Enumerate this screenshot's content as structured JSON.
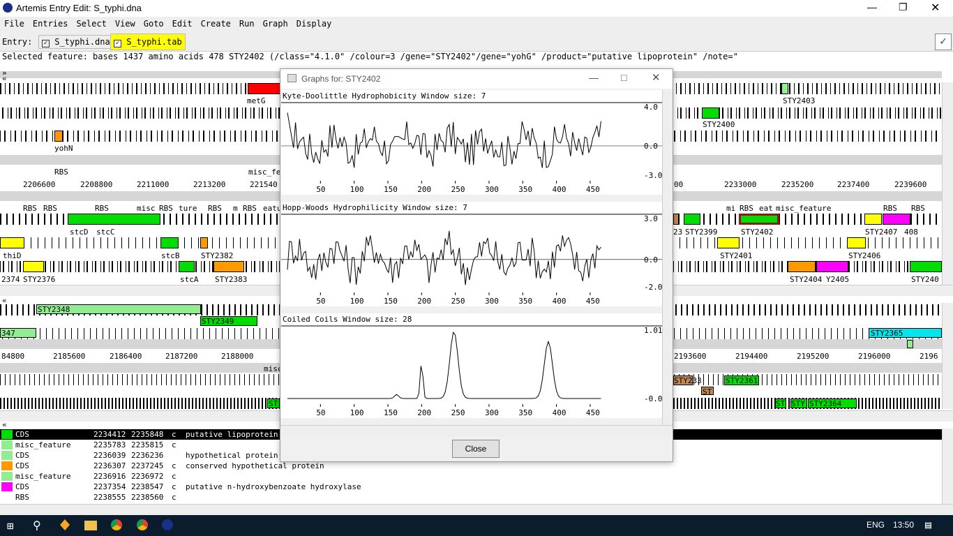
{
  "window": {
    "title": "Artemis Entry Edit: S_typhi.dna"
  },
  "menu": [
    "File",
    "Entries",
    "Select",
    "View",
    "Goto",
    "Edit",
    "Create",
    "Run",
    "Graph",
    "Display"
  ],
  "entry": {
    "label": "Entry:",
    "entries": [
      {
        "name": "S_typhi.dna",
        "checked": true
      },
      {
        "name": "S_typhi.tab",
        "checked": true
      }
    ]
  },
  "selected_feature": "Selected feature:  bases 1437  amino acids 478  STY2402  (/class=\"4.1.0\" /colour=3 /gene=\"STY2402\"/gene=\"yohG\" /product=\"putative lipoprotein\" /note=\"",
  "upper_view": {
    "left_labels": [
      "metG",
      "yohN",
      "RBS",
      "misc_fe",
      "stcD",
      "stcC",
      "thiD",
      "stcB",
      "STY2382",
      "STY2376",
      "stcA",
      "STY2383",
      "2374"
    ],
    "right_labels": [
      "STY2403",
      "STY2400",
      "STY2399",
      "STY2402",
      "STY2407",
      "408",
      "STY2401",
      "STY2406",
      "STY2404",
      "Y2405",
      "STY240",
      "23",
      "mi",
      "RBS",
      "eat",
      "misc_feature",
      "RBS",
      "RBS"
    ],
    "rbs_labels": [
      "RBS",
      "RBS",
      "RBS",
      "misc",
      "RBS",
      "ture",
      "RBS",
      "m",
      "RBS",
      "eatu"
    ],
    "ruler_left": [
      "2206600",
      "2208800",
      "2211000",
      "2213200",
      "221540"
    ],
    "ruler_right": [
      "00",
      "2233000",
      "2235200",
      "2237400",
      "2239600"
    ]
  },
  "lower_view": {
    "labels": [
      "STY2348",
      "STY2349",
      "347",
      "misc",
      "STY2365",
      "STY233",
      "ST",
      "STY2361",
      "ST",
      "STY",
      "STY2364",
      "ST"
    ],
    "ruler_left": [
      "84800",
      "2185600",
      "2186400",
      "2187200",
      "2188000"
    ],
    "ruler_right": [
      "2193600",
      "2194400",
      "2195200",
      "2196000",
      "2196"
    ]
  },
  "dialog": {
    "title": "Graphs for: STY2402",
    "close_label": "Close",
    "graphs": [
      {
        "title": "Kyte-Doolittle Hydrophobicity  Window size: 7",
        "ymax": "4.0",
        "ymid": "0.0",
        "ymin": "-3.0"
      },
      {
        "title": "Hopp-Woods Hydrophilicity  Window size: 7",
        "ymax": "3.0",
        "ymid": "0.0",
        "ymin": "-2.0"
      },
      {
        "title": "Coiled Coils  Window size: 28",
        "ymax": "1.01",
        "ymin": "-0.01"
      }
    ],
    "x_ticks": [
      "50",
      "100",
      "150",
      "200",
      "250",
      "300",
      "350",
      "400",
      "450"
    ]
  },
  "feature_list": [
    {
      "key": "CDS",
      "start": "2234412",
      "end": "2235848",
      "strand": "c",
      "note": "putative lipoprotein",
      "color": "#00dd00",
      "selected": true
    },
    {
      "key": "misc_feature",
      "start": "2235783",
      "end": "2235815",
      "strand": "c",
      "note": "",
      "color": "#90ee90",
      "selected": false
    },
    {
      "key": "CDS",
      "start": "2236039",
      "end": "2236236",
      "strand": "",
      "note": "hypothetical protein",
      "color": "#90ee90",
      "selected": false
    },
    {
      "key": "CDS",
      "start": "2236307",
      "end": "2237245",
      "strand": "c",
      "note": "conserved hypothetical protein",
      "color": "#ff9900",
      "selected": false
    },
    {
      "key": "misc_feature",
      "start": "2236916",
      "end": "2236972",
      "strand": "c",
      "note": "",
      "color": "#90ee90",
      "selected": false
    },
    {
      "key": "CDS",
      "start": "2237354",
      "end": "2238547",
      "strand": "c",
      "note": "putative n-hydroxybenzoate hydroxylase",
      "color": "#ff00ff",
      "selected": false
    },
    {
      "key": "RBS",
      "start": "2238555",
      "end": "2238560",
      "strand": "c",
      "note": "",
      "color": "#ffffff",
      "selected": false
    }
  ],
  "taskbar": {
    "language": "ENG",
    "time": "13:50"
  }
}
